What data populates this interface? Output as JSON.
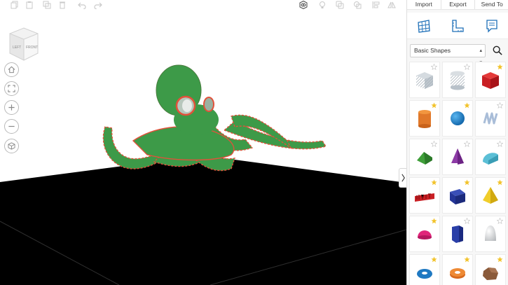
{
  "toolbar": {
    "left_icons": [
      "copy-icon",
      "paste-icon",
      "duplicate-icon",
      "delete-icon",
      "undo-icon",
      "redo-icon"
    ],
    "center_icons": [
      "visibility-icon",
      "lightbulb-icon",
      "group-icon",
      "ungroup-icon",
      "align-icon",
      "mirror-icon"
    ]
  },
  "panel": {
    "tabs": [
      {
        "label": "Import"
      },
      {
        "label": "Export"
      },
      {
        "label": "Send To"
      }
    ],
    "icons": [
      "workplane-icon",
      "ruler-icon",
      "notes-icon"
    ],
    "shape_select": {
      "value": "Basic Shapes"
    },
    "shapes": [
      {
        "name": "box-hole",
        "starred": false
      },
      {
        "name": "cylinder-hole",
        "starred": false
      },
      {
        "name": "box",
        "starred": true
      },
      {
        "name": "cylinder",
        "starred": true
      },
      {
        "name": "sphere",
        "starred": true
      },
      {
        "name": "scribble",
        "starred": false
      },
      {
        "name": "roof",
        "starred": false
      },
      {
        "name": "cone",
        "starred": false
      },
      {
        "name": "round-roof",
        "starred": false
      },
      {
        "name": "text",
        "starred": true
      },
      {
        "name": "wedge",
        "starred": true
      },
      {
        "name": "pyramid",
        "starred": true
      },
      {
        "name": "half-sphere",
        "starred": true
      },
      {
        "name": "polygon",
        "starred": false
      },
      {
        "name": "paraboloid",
        "starred": false
      },
      {
        "name": "torus",
        "starred": true
      },
      {
        "name": "tube",
        "starred": true
      },
      {
        "name": "rock",
        "starred": true
      }
    ]
  },
  "viewcube": {
    "left": "LEFT",
    "front": "FRONT"
  },
  "view_controls": [
    "home-icon",
    "fit-view-icon",
    "zoom-in-icon",
    "zoom-out-icon",
    "ortho-view-icon"
  ],
  "colors": {
    "octopus": "#3d9a48",
    "octopus_outline": "#e2513a",
    "ground": "#000000"
  }
}
